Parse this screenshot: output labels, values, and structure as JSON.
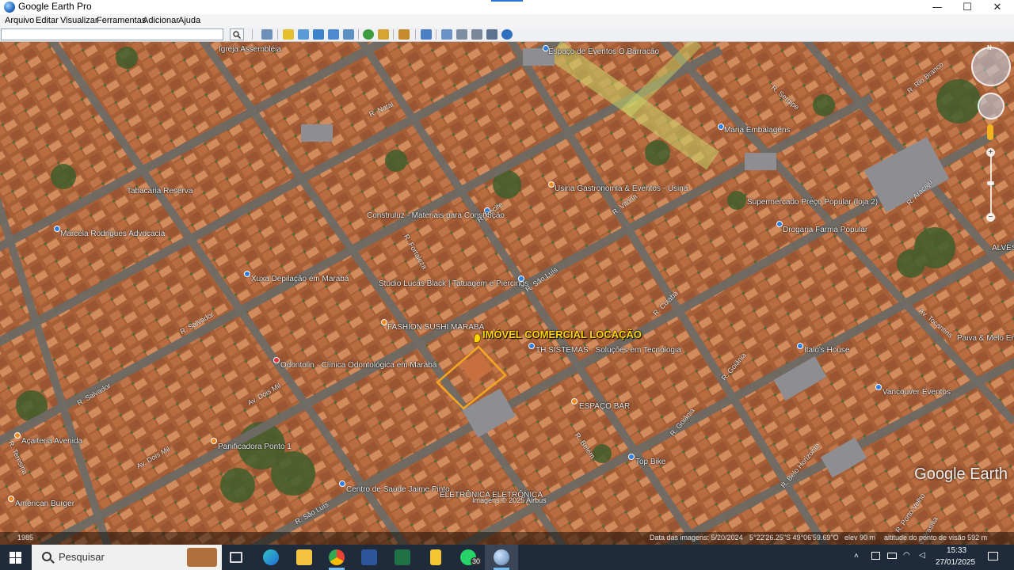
{
  "window": {
    "title": "Google Earth Pro",
    "minimize_glyph": "—",
    "maximize_glyph": "☐",
    "close_glyph": "✕"
  },
  "menu": {
    "items": [
      "Arquivo",
      "Editar",
      "Visualizar",
      "Ferramentas",
      "Adicionar",
      "Ajuda"
    ]
  },
  "toolbar": {
    "search_value": "",
    "search_icon": "search-icon"
  },
  "map": {
    "highlight_label": "IMÓVEL COMERCIAL LOCAÇÃO",
    "places": [
      {
        "id": "igreja",
        "text": "Igreja Assembléia",
        "pin": "none"
      },
      {
        "id": "tabacaria",
        "text": "Tabacaria Reserva",
        "pin": "none"
      },
      {
        "id": "espaco",
        "text": "Espaço de Eventos O Barracão",
        "pin": "blue"
      },
      {
        "id": "maria",
        "text": "Maria Embalagens",
        "pin": "blue"
      },
      {
        "id": "usina",
        "text": "Usina Gastronomia & Eventos - Usina",
        "pin": "orange"
      },
      {
        "id": "construluz",
        "text": "Construluz - Materiais para Construção",
        "pin": "blue"
      },
      {
        "id": "supermercado",
        "text": "Supermercado Preço Popular (loja 2)",
        "pin": "blue"
      },
      {
        "id": "drogaria",
        "text": "Drogaria Farma Popular",
        "pin": "blue"
      },
      {
        "id": "marcela",
        "text": "Marcela Rodrigues Advocacia",
        "pin": "blue"
      },
      {
        "id": "depilacao",
        "text": "Xuxa Depilação em Marabá",
        "pin": "blue"
      },
      {
        "id": "tatuagem",
        "text": "Studio Lucas Black | Tatuagem e Piercings",
        "pin": "blue"
      },
      {
        "id": "fashion",
        "text": "FASHION SUSHI MARABÁ",
        "pin": "orange"
      },
      {
        "id": "th",
        "text": "TH SISTEMAS - Soluções em Tecnologia",
        "pin": "blue"
      },
      {
        "id": "odonto",
        "text": "Odontolin - Clínica Odontológica em Marabá",
        "pin": "red"
      },
      {
        "id": "italo",
        "text": "Italo's House",
        "pin": "blue"
      },
      {
        "id": "vancouver",
        "text": "Vancouver Eventos",
        "pin": "blue"
      },
      {
        "id": "espacobar",
        "text": "ESPAÇO BAR",
        "pin": "orange"
      },
      {
        "id": "topbike",
        "text": "Top Bike",
        "pin": "blue"
      },
      {
        "id": "acaiteria",
        "text": "Açaiteria Avenida",
        "pin": "orange"
      },
      {
        "id": "panificadora",
        "text": "Panificadora Ponto 1",
        "pin": "orange"
      },
      {
        "id": "centro",
        "text": "Centro de Saúde Jaime Pinto",
        "pin": "blue"
      },
      {
        "id": "american",
        "text": "American Burger",
        "pin": "orange"
      },
      {
        "id": "eletronica",
        "text": "ELETRÔNICA ELETRÔNICA",
        "pin": "none"
      },
      {
        "id": "paiva",
        "text": "Paiva & Melo Emp",
        "pin": "none"
      },
      {
        "id": "alves",
        "text": "ALVES",
        "pin": "none"
      }
    ],
    "roads": [
      "R. Salvador",
      "R. Goiânia",
      "R. São Luís",
      "Av. Dois Mil",
      "R. Cuiabá",
      "R. Belo Horizonte",
      "R. Porto Velho",
      "R. Belém",
      "R. Fortaleza",
      "R. Vitória",
      "Av. Tocantins",
      "R. Teresina",
      "R. Natal",
      "R. Recife",
      "R. Aracaju",
      "R. Sergipe",
      "R. Rio Branco",
      "Av. Brasília"
    ],
    "image_credit": "Imagens © 2025 Airbus",
    "google_earth_logo": "Google Earth"
  },
  "status": {
    "year": "1985",
    "image_date": "Data das imagens: 5/20/2024",
    "coordinates": "5°22'26.25\"S   49°06'59.69\"O",
    "elevation": "elev   90 m",
    "eye_altitude": "altitude do ponto de visão   592 m"
  },
  "taskbar": {
    "search_placeholder": "Pesquisar",
    "whatsapp_badge": "30",
    "time": "15:33",
    "date": "27/01/2025"
  },
  "colors": {
    "highlight": "#ffd400",
    "accent_blue": "#2a73d9",
    "taskbar": "#1f2a3a"
  }
}
